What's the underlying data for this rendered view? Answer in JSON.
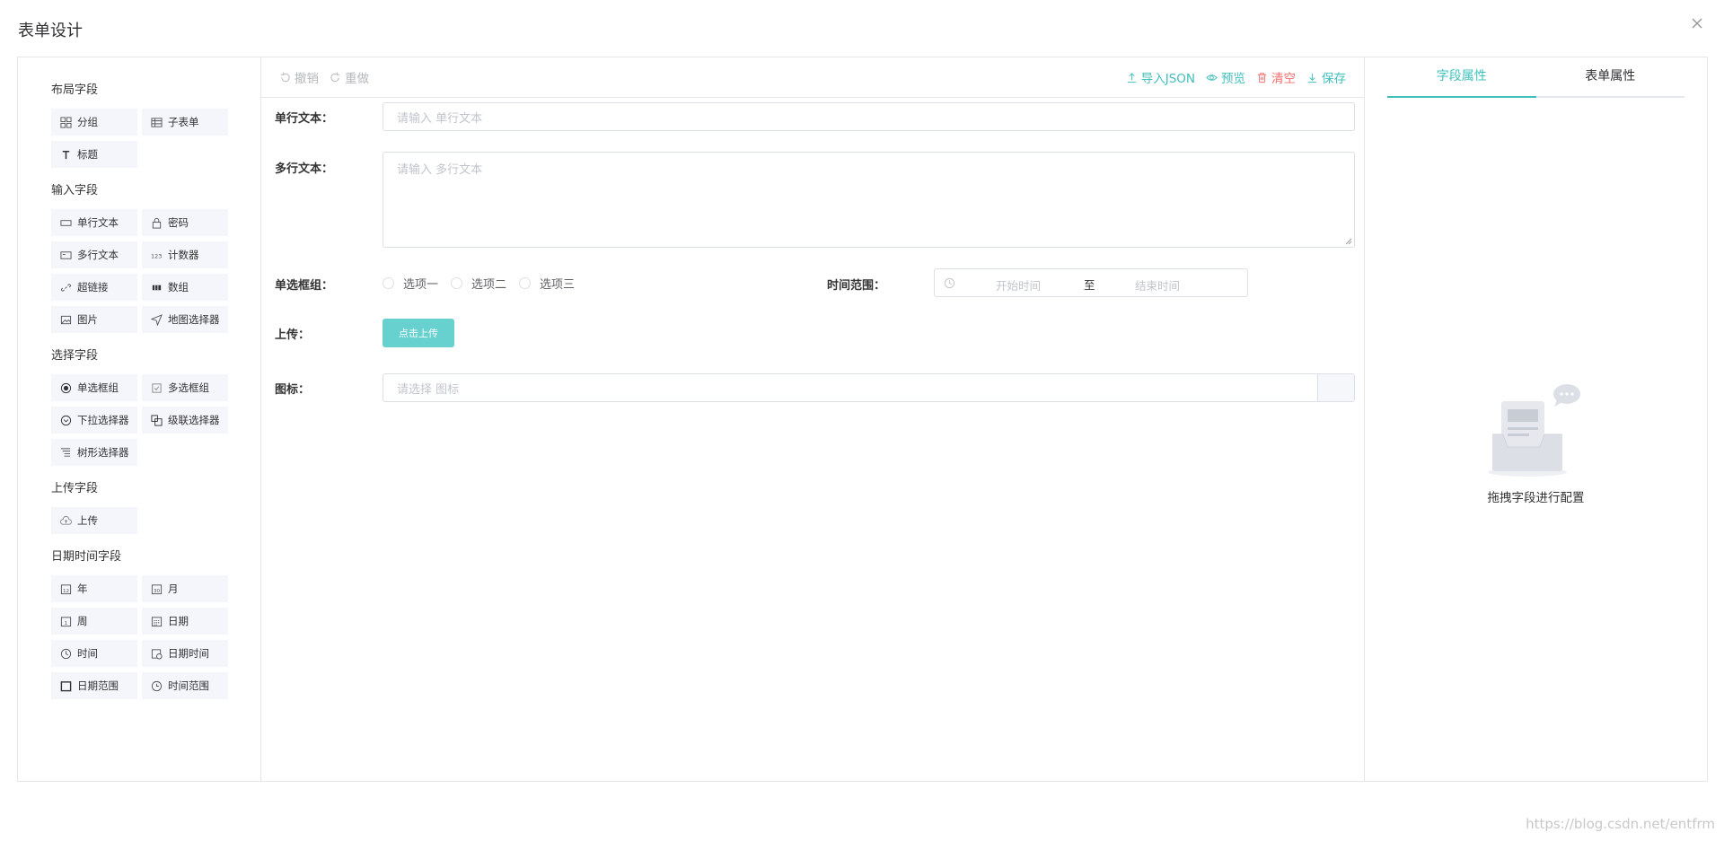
{
  "dialog": {
    "title": "表单设计"
  },
  "left": {
    "groups": [
      {
        "title": "布局字段",
        "items": [
          {
            "label": "分组",
            "icon": "grid-icon"
          },
          {
            "label": "子表单",
            "icon": "table-icon"
          },
          {
            "label": "标题",
            "icon": "title-icon"
          }
        ]
      },
      {
        "title": "输入字段",
        "items": [
          {
            "label": "单行文本",
            "icon": "input-icon"
          },
          {
            "label": "密码",
            "icon": "lock-icon"
          },
          {
            "label": "多行文本",
            "icon": "textarea-icon"
          },
          {
            "label": "计数器",
            "icon": "counter-icon"
          },
          {
            "label": "超链接",
            "icon": "link-icon"
          },
          {
            "label": "数组",
            "icon": "array-icon"
          },
          {
            "label": "图片",
            "icon": "image-icon"
          },
          {
            "label": "地图选择器",
            "icon": "map-icon"
          }
        ]
      },
      {
        "title": "选择字段",
        "items": [
          {
            "label": "单选框组",
            "icon": "radio-icon"
          },
          {
            "label": "多选框组",
            "icon": "checkbox-icon"
          },
          {
            "label": "下拉选择器",
            "icon": "select-icon"
          },
          {
            "label": "级联选择器",
            "icon": "cascader-icon"
          },
          {
            "label": "树形选择器",
            "icon": "tree-icon"
          }
        ]
      },
      {
        "title": "上传字段",
        "items": [
          {
            "label": "上传",
            "icon": "upload-cloud-icon"
          }
        ]
      },
      {
        "title": "日期时间字段",
        "items": [
          {
            "label": "年",
            "icon": "year-icon"
          },
          {
            "label": "月",
            "icon": "month-icon"
          },
          {
            "label": "周",
            "icon": "week-icon"
          },
          {
            "label": "日期",
            "icon": "date-icon"
          },
          {
            "label": "时间",
            "icon": "clock-icon"
          },
          {
            "label": "日期时间",
            "icon": "datetime-icon"
          },
          {
            "label": "日期范围",
            "icon": "daterange-icon"
          },
          {
            "label": "时间范围",
            "icon": "timerange-icon"
          }
        ]
      }
    ]
  },
  "toolbar": {
    "undo": "撤销",
    "redo": "重做",
    "import_json": "导入JSON",
    "preview": "预览",
    "clear": "清空",
    "save": "保存"
  },
  "form": {
    "single_label": "单行文本：",
    "single_placeholder": "请输入 单行文本",
    "multi_label": "多行文本：",
    "multi_placeholder": "请输入 多行文本",
    "radio_label": "单选框组：",
    "radio_options": [
      "选项一",
      "选项二",
      "选项三"
    ],
    "time_range_label": "时间范围：",
    "time_start": "开始时间",
    "time_sep": "至",
    "time_end": "结束时间",
    "upload_label": "上传：",
    "upload_button": "点击上传",
    "icon_label": "图标：",
    "icon_placeholder": "请选择 图标"
  },
  "right": {
    "tabs": [
      "字段属性",
      "表单属性"
    ],
    "empty_text": "拖拽字段进行配置"
  },
  "watermark": "https://blog.csdn.net/entfrm",
  "colors": {
    "accent": "#41c0be",
    "danger": "#f56c6c",
    "panel_bg": "#f4f6fc"
  }
}
